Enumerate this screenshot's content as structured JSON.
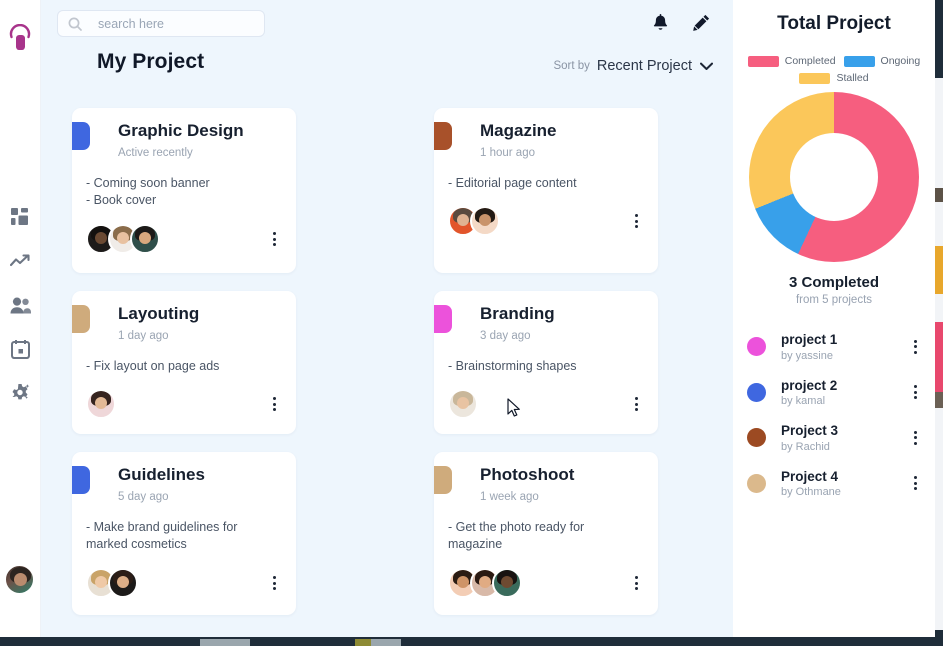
{
  "app": {
    "logo_icon": "app-logo-mark",
    "accent": "#b5338a"
  },
  "sidebar": {
    "items": [
      {
        "icon": "dashboard-grid-icon",
        "name": "dashboard"
      },
      {
        "icon": "trending-up-icon",
        "name": "analytics"
      },
      {
        "icon": "people-icon",
        "name": "team"
      },
      {
        "icon": "calendar-icon",
        "name": "calendar"
      },
      {
        "icon": "gear-sparkle-icon",
        "name": "settings"
      }
    ],
    "avatar_label": "user-avatar"
  },
  "topbar": {
    "search": {
      "placeholder": "search here",
      "value": "",
      "icon": "search-icon"
    },
    "notification_icon": "bell-icon",
    "edit_icon": "pencil-icon"
  },
  "header": {
    "title": "My Project",
    "sort_label": "Sort by",
    "sort_value": "Recent Project",
    "sort_caret_icon": "chevron-down-icon"
  },
  "cards": [
    {
      "title": "Graphic Design",
      "subtitle": "Active recently",
      "accent": "#3f67e0",
      "tasks": [
        "- Coming soon banner",
        "- Book cover"
      ],
      "avatars": [
        {
          "bg": "#1d1b1a",
          "hair": "#14110f",
          "face": "#6b4a33"
        },
        {
          "bg": "#f0ece8",
          "hair": "#8a6c4a",
          "face": "#e8c1a0"
        },
        {
          "bg": "#2f4f4a",
          "hair": "#1d1a18",
          "face": "#d9a87e"
        }
      ],
      "menu_icon": "more-vertical-icon"
    },
    {
      "title": "Magazine",
      "subtitle": "1 hour ago",
      "accent": "#a8512a",
      "tasks": [
        "- Editorial page content"
      ],
      "avatars": [
        {
          "bg": "#e2552b",
          "hair": "#5a4a3e",
          "face": "#e0b392"
        },
        {
          "bg": "#f4d9c6",
          "hair": "#231a14",
          "face": "#c9936a"
        }
      ],
      "menu_icon": "more-vertical-icon"
    },
    {
      "title": "Layouting",
      "subtitle": "1 day ago",
      "accent": "#cfab7c",
      "tasks": [
        "- Fix layout on page ads"
      ],
      "avatars": [
        {
          "bg": "#efd7d9",
          "hair": "#36241f",
          "face": "#e3b996"
        }
      ],
      "menu_icon": "more-vertical-icon"
    },
    {
      "title": "Branding",
      "subtitle": "3 day ago",
      "accent": "#ec52db",
      "tasks": [
        "- Brainstorming shapes"
      ],
      "avatars": [
        {
          "bg": "#ece6dd",
          "hair": "#c9b79a",
          "face": "#e8c3a2"
        }
      ],
      "menu_icon": "more-vertical-icon"
    },
    {
      "title": "Guidelines",
      "subtitle": "5 day ago",
      "accent": "#3f67e0",
      "tasks": [
        "- Make brand guidelines for",
        "marked cosmetics"
      ],
      "avatars": [
        {
          "bg": "#e8e0d4",
          "hair": "#c9a368",
          "face": "#efc9a6"
        },
        {
          "bg": "#1c1a19",
          "hair": "#2b1d16",
          "face": "#dcae87"
        }
      ],
      "menu_icon": "more-vertical-icon"
    },
    {
      "title": "Photoshoot",
      "subtitle": "1 week ago",
      "accent": "#cfab7c",
      "tasks": [
        "- Get the photo ready for",
        "magazine"
      ],
      "avatars": [
        {
          "bg": "#f3cdb5",
          "hair": "#2b1c13",
          "face": "#cf9467"
        },
        {
          "bg": "#d8b9a8",
          "hair": "#2a1a12",
          "face": "#e0ab83"
        },
        {
          "bg": "#3a6b5c",
          "hair": "#181311",
          "face": "#6e4a31"
        }
      ],
      "menu_icon": "more-vertical-icon"
    }
  ],
  "right_panel": {
    "title": "Total Project",
    "completed_caption": "3 Completed",
    "completed_sub": "from 5 projects",
    "projects": [
      {
        "name": "project 1",
        "by": "by yassine",
        "color": "#ec52db",
        "menu_icon": "more-vertical-icon"
      },
      {
        "name": "project 2",
        "by": "by kamal",
        "color": "#3f67e0",
        "menu_icon": "more-vertical-icon"
      },
      {
        "name": "Project 3",
        "by": "by Rachid",
        "color": "#9c4a22",
        "menu_icon": "more-vertical-icon"
      },
      {
        "name": "Project 4",
        "by": "by Othmane",
        "color": "#dbb98c",
        "menu_icon": "more-vertical-icon"
      }
    ]
  },
  "chart_data": {
    "type": "pie",
    "title": "Total Project",
    "subtitle": "3 Completed from 5 projects",
    "donut": true,
    "legend_position": "top",
    "categories": [
      "Completed",
      "Ongoing",
      "Stalled"
    ],
    "values": [
      57,
      12,
      31
    ],
    "colors": [
      "#f65e7f",
      "#38a0ea",
      "#fbc75a"
    ],
    "start_angle_deg": 0,
    "segments": [
      {
        "label": "Completed",
        "value": 57,
        "color": "#f65e7f",
        "start_deg": 0,
        "end_deg": 205
      },
      {
        "label": "Ongoing",
        "value": 12,
        "color": "#38a0ea",
        "start_deg": 205,
        "end_deg": 248
      },
      {
        "label": "Stalled",
        "value": 31,
        "color": "#fbc75a",
        "start_deg": 248,
        "end_deg": 360
      }
    ],
    "center_text": "3 Completed",
    "center_subtext": "from 5 projects"
  }
}
